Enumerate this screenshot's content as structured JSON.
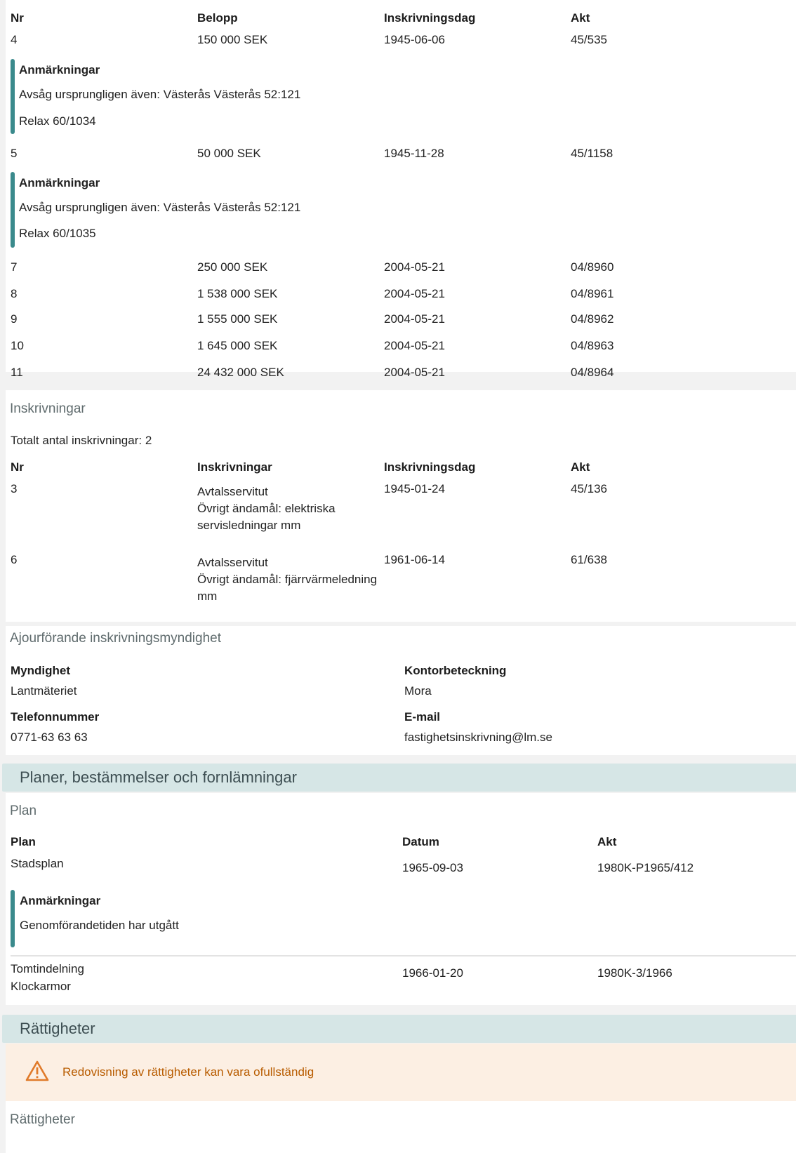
{
  "pantbrev": {
    "headers": {
      "nr": "Nr",
      "belopp": "Belopp",
      "dag": "Inskrivningsdag",
      "akt": "Akt"
    },
    "note_title": "Anmärkningar",
    "rows": [
      {
        "nr": "4",
        "belopp": "150 000 SEK",
        "dag": "1945-06-06",
        "akt": "45/535",
        "note_lines": [
          "Avsåg ursprungligen även: Västerås Västerås 52:121",
          "Relax 60/1034"
        ]
      },
      {
        "nr": "5",
        "belopp": "50 000 SEK",
        "dag": "1945-11-28",
        "akt": "45/1158",
        "note_lines": [
          "Avsåg ursprungligen även: Västerås Västerås 52:121",
          "Relax 60/1035"
        ]
      },
      {
        "nr": "7",
        "belopp": "250 000 SEK",
        "dag": "2004-05-21",
        "akt": "04/8960"
      },
      {
        "nr": "8",
        "belopp": "1 538 000 SEK",
        "dag": "2004-05-21",
        "akt": "04/8961"
      },
      {
        "nr": "9",
        "belopp": "1 555 000 SEK",
        "dag": "2004-05-21",
        "akt": "04/8962"
      },
      {
        "nr": "10",
        "belopp": "1 645 000 SEK",
        "dag": "2004-05-21",
        "akt": "04/8963"
      },
      {
        "nr": "11",
        "belopp": "24 432 000 SEK",
        "dag": "2004-05-21",
        "akt": "04/8964"
      }
    ]
  },
  "inskrivningar": {
    "title": "Inskrivningar",
    "total": "Totalt antal inskrivningar: 2",
    "headers": {
      "nr": "Nr",
      "inskr": "Inskrivningar",
      "dag": "Inskrivningsdag",
      "akt": "Akt"
    },
    "rows": [
      {
        "nr": "3",
        "line1": "Avtalsservitut",
        "line2": "Övrigt ändamål: elektriska servisledningar mm",
        "dag": "1945-01-24",
        "akt": "45/136"
      },
      {
        "nr": "6",
        "line1": "Avtalsservitut",
        "line2": "Övrigt ändamål: fjärrvärmeledning mm",
        "dag": "1961-06-14",
        "akt": "61/638"
      }
    ]
  },
  "myndighet": {
    "title": "Ajourförande inskrivningsmyndighet",
    "myndighet_label": "Myndighet",
    "myndighet_value": "Lantmäteriet",
    "kontor_label": "Kontorbeteckning",
    "kontor_value": "Mora",
    "telefon_label": "Telefonnummer",
    "telefon_value": "0771-63 63 63",
    "email_label": "E-mail",
    "email_value": "fastighetsinskrivning@lm.se"
  },
  "planer": {
    "section_title": "Planer, bestämmelser och fornlämningar",
    "subtitle": "Plan",
    "headers": {
      "plan": "Plan",
      "datum": "Datum",
      "akt": "Akt"
    },
    "row1": {
      "plan": "Stadsplan",
      "datum": "1965-09-03",
      "akt": "1980K-P1965/412",
      "note_title": "Anmärkningar",
      "note": "Genomförandetiden har utgått"
    },
    "row2": {
      "plan_line1": "Tomtindelning",
      "plan_line2": "Klockarmor",
      "datum": "1966-01-20",
      "akt": "1980K-3/1966"
    }
  },
  "rattigheter": {
    "section_title": "Rättigheter",
    "warning_icon": "warning-triangle-icon",
    "warning_text": "Redovisning av rättigheter kan vara ofullständig",
    "subtitle": "Rättigheter"
  },
  "colors": {
    "accent": "#3a8a8c",
    "section_bg": "#d6e6e6",
    "warning_bg": "#fcefe3",
    "warning_text": "#b85c00"
  }
}
